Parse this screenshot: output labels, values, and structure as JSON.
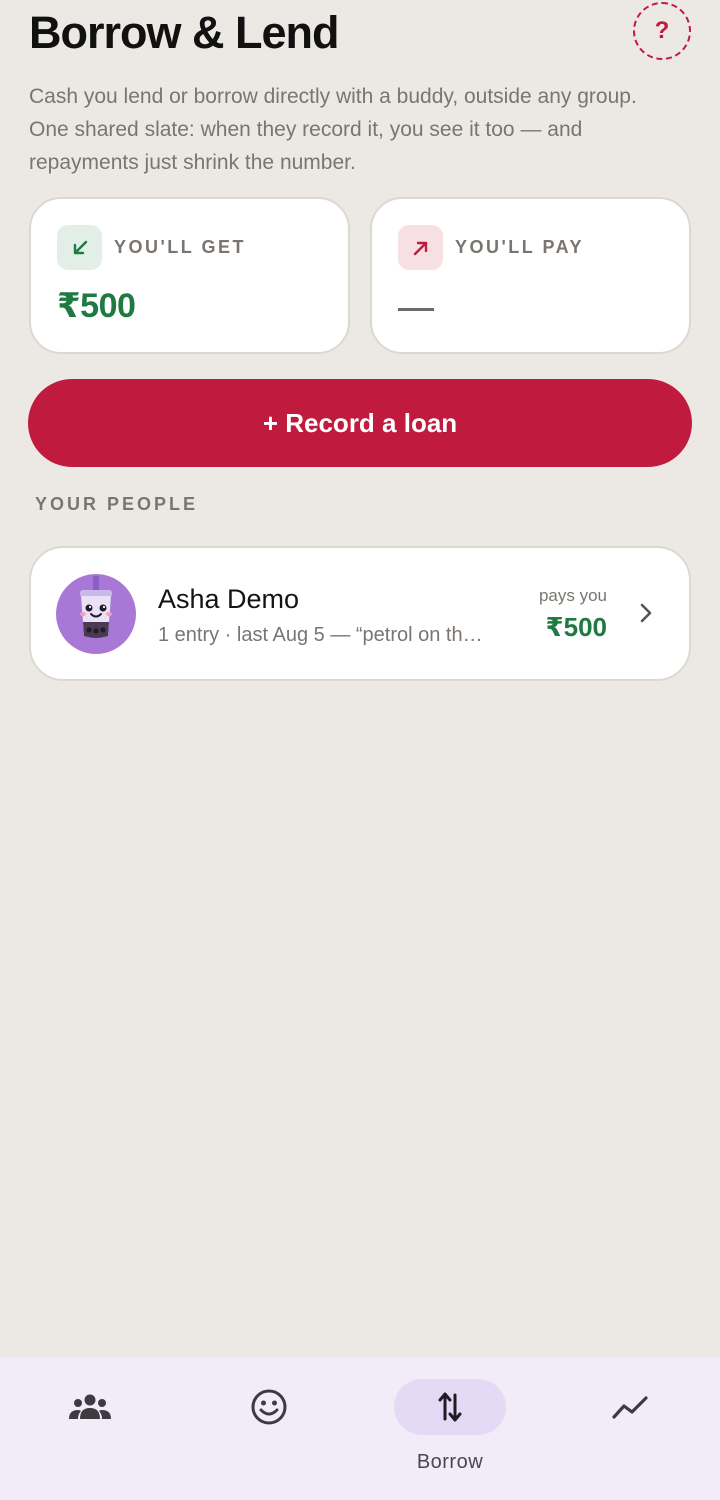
{
  "header": {
    "title": "Borrow & Lend",
    "help_icon": "?",
    "subtitle": "Cash you lend or borrow directly with a buddy, outside any group. One shared slate: when they record it, you see it too — and repayments just shrink the number."
  },
  "summary": {
    "get": {
      "label": "YOU'LL GET",
      "amount": "₹500",
      "icon": "arrow-down-left-icon",
      "color": "#1e7a40"
    },
    "pay": {
      "label": "YOU'LL PAY",
      "amount": "—",
      "icon": "arrow-up-right-icon",
      "color": "#c01a3e"
    }
  },
  "record_button": {
    "label": "+ Record a loan"
  },
  "people_section": {
    "label": "YOUR PEOPLE",
    "people": [
      {
        "name": "Asha Demo",
        "meta": "1 entry · last Aug 5 — “petrol on th…",
        "direction": "pays you",
        "amount": "₹500",
        "avatar": "bubble-tea-avatar"
      }
    ]
  },
  "bottom_nav": {
    "items": [
      {
        "icon": "groups-icon",
        "label": ""
      },
      {
        "icon": "smiley-icon",
        "label": ""
      },
      {
        "icon": "swap-vertical-icon",
        "label": "Borrow",
        "active": true
      },
      {
        "icon": "trend-line-icon",
        "label": ""
      }
    ]
  },
  "colors": {
    "accent": "#c01a3e",
    "positive": "#1e7a40",
    "background": "#ece9e4"
  }
}
